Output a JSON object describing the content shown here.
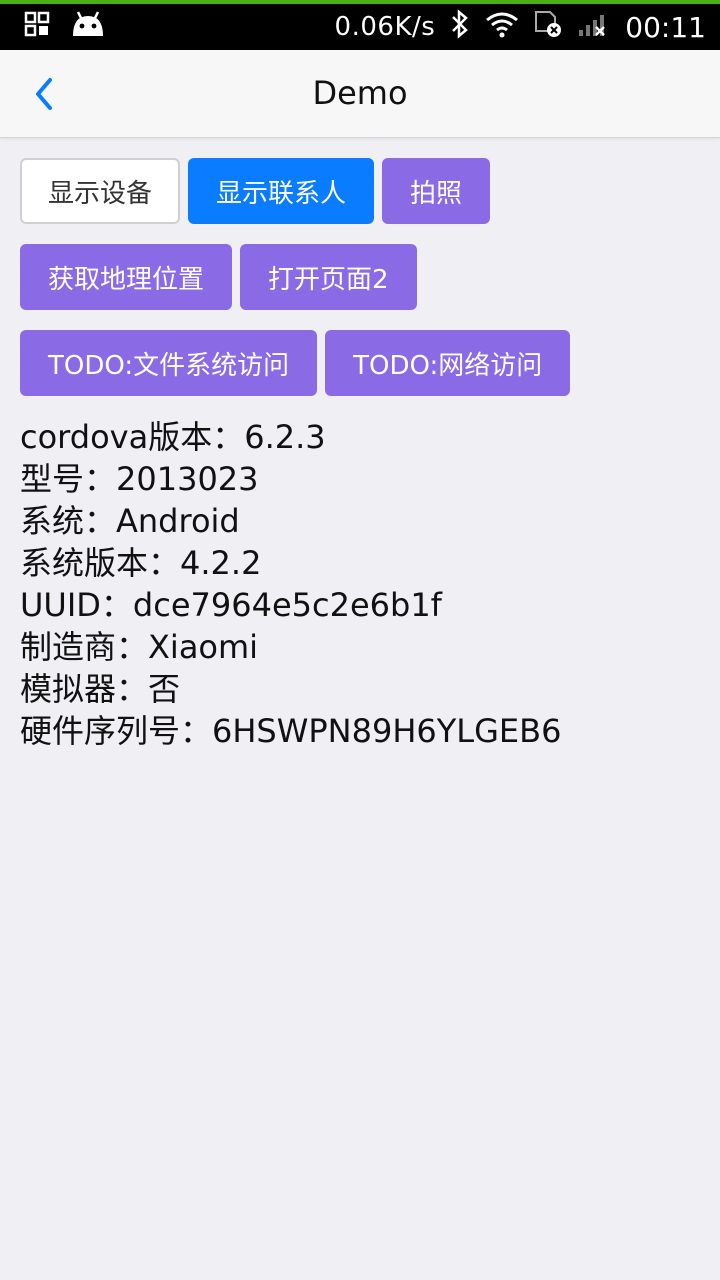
{
  "status_bar": {
    "speed": "0.06K/s",
    "time": "00:11",
    "icons": [
      "grid-icon",
      "android-icon",
      "bluetooth-icon",
      "wifi-icon",
      "sim-error-icon",
      "signal-icon"
    ]
  },
  "nav": {
    "title": "Demo",
    "back_icon": "chevron-left-icon"
  },
  "buttons": [
    [
      {
        "label": "显示设备",
        "style": "outline"
      },
      {
        "label": "显示联系人",
        "style": "blue"
      },
      {
        "label": "拍照",
        "style": "purple"
      }
    ],
    [
      {
        "label": "获取地理位置",
        "style": "purple"
      },
      {
        "label": "打开页面2",
        "style": "purple"
      }
    ],
    [
      {
        "label": "TODO:文件系统访问",
        "style": "purple"
      },
      {
        "label": "TODO:网络访问",
        "style": "purple"
      }
    ]
  ],
  "device_info": [
    "cordova版本：6.2.3",
    "型号：2013023",
    "系统：Android",
    "系统版本：4.2.2",
    "UUID：dce7964e5c2e6b1f",
    "制造商：Xiaomi",
    "模拟器：否",
    "硬件序列号：6HSWPN89H6YLGEB6"
  ],
  "colors": {
    "accent_blue": "#0a7cff",
    "accent_purple": "#8b6ae6",
    "background": "#efeff4",
    "status_bar_top": "#4caf1a"
  }
}
